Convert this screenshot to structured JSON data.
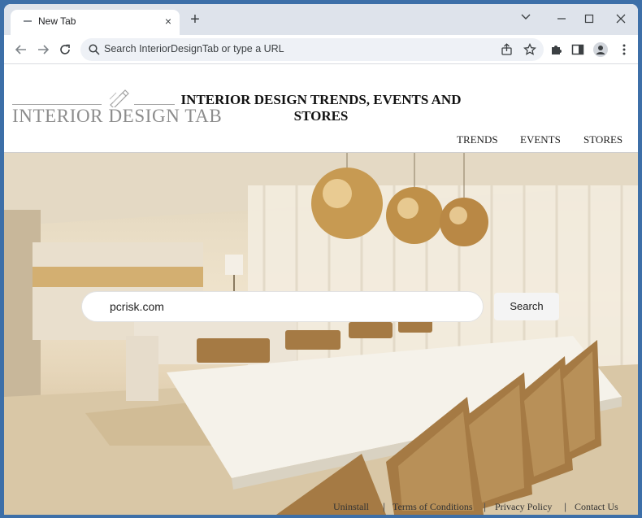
{
  "browser": {
    "tab_title": "New Tab",
    "new_tab_label": "+",
    "tab_close_label": "×",
    "omnibox_placeholder": "Search InteriorDesignTab or type a URL"
  },
  "site": {
    "logo_text": "INTERIOR DESIGN TAB",
    "heading": "INTERIOR DESIGN TRENDS, EVENTS AND STORES",
    "nav": [
      "TRENDS",
      "EVENTS",
      "STORES"
    ]
  },
  "search": {
    "value": "pcrisk.com",
    "button_label": "Search"
  },
  "footer": {
    "links": [
      "Uninstall",
      "Terms of Conditions",
      "Privacy Policy",
      "Contact Us"
    ],
    "separator": "|"
  },
  "colors": {
    "window_frame": "#3d6fa8",
    "tabstrip_bg": "#dee3eb",
    "omnibox_bg": "#eef1f6"
  }
}
